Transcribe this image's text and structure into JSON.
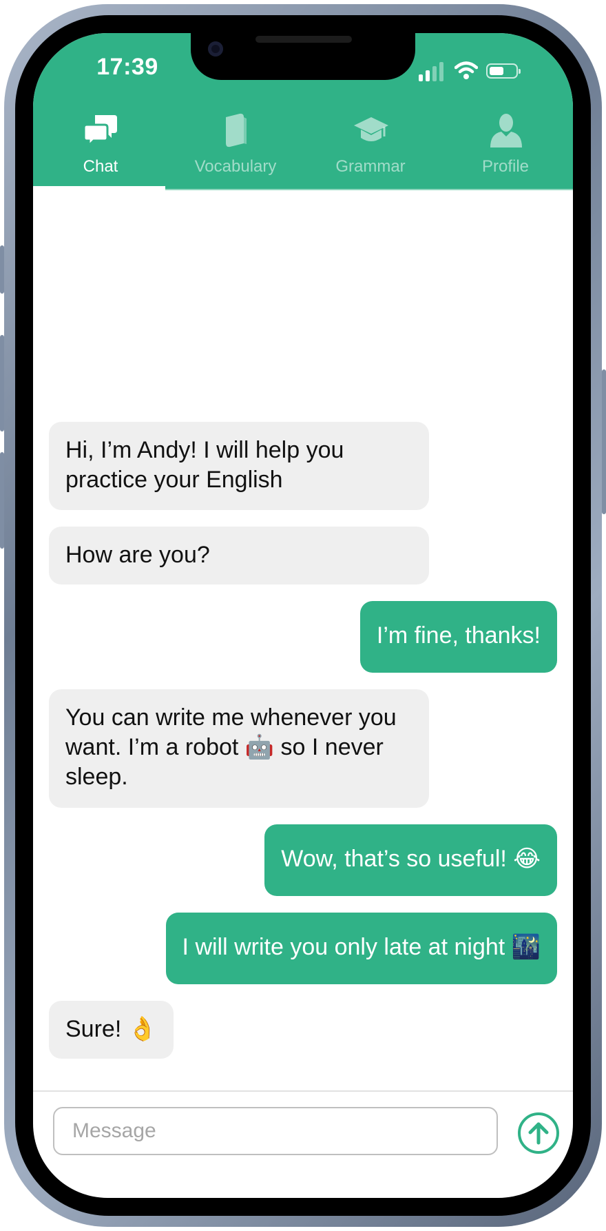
{
  "status_bar": {
    "time": "17:39",
    "icons": [
      "cellular-signal-icon",
      "wifi-icon",
      "battery-icon"
    ],
    "battery_level": 0.45
  },
  "tabs": [
    {
      "label": "Chat",
      "icon": "chat-bubbles-icon",
      "active": true
    },
    {
      "label": "Vocabulary",
      "icon": "book-icon",
      "active": false
    },
    {
      "label": "Grammar",
      "icon": "graduation-cap-icon",
      "active": false
    },
    {
      "label": "Profile",
      "icon": "person-icon",
      "active": false
    }
  ],
  "messages": [
    {
      "sender": "bot",
      "text": "Hi, I’m Andy! I will help you practice your English"
    },
    {
      "sender": "bot",
      "text": "How are you?"
    },
    {
      "sender": "user",
      "text": "I’m fine, thanks!"
    },
    {
      "sender": "bot",
      "text": "You can write me whenever you want. I’m a robot 🤖 so I never sleep."
    },
    {
      "sender": "user",
      "text": "Wow, that’s so useful! 😂"
    },
    {
      "sender": "user",
      "text": "I will write you only late at night 🌃"
    },
    {
      "sender": "bot",
      "text": "Sure! 👌"
    }
  ],
  "composer": {
    "placeholder": "Message",
    "value": "",
    "send_icon": "arrow-up-circle-icon"
  },
  "colors": {
    "accent": "#30b287",
    "incoming_bubble": "#efefef",
    "tab_inactive": "rgba(255,255,255,0.55)"
  }
}
